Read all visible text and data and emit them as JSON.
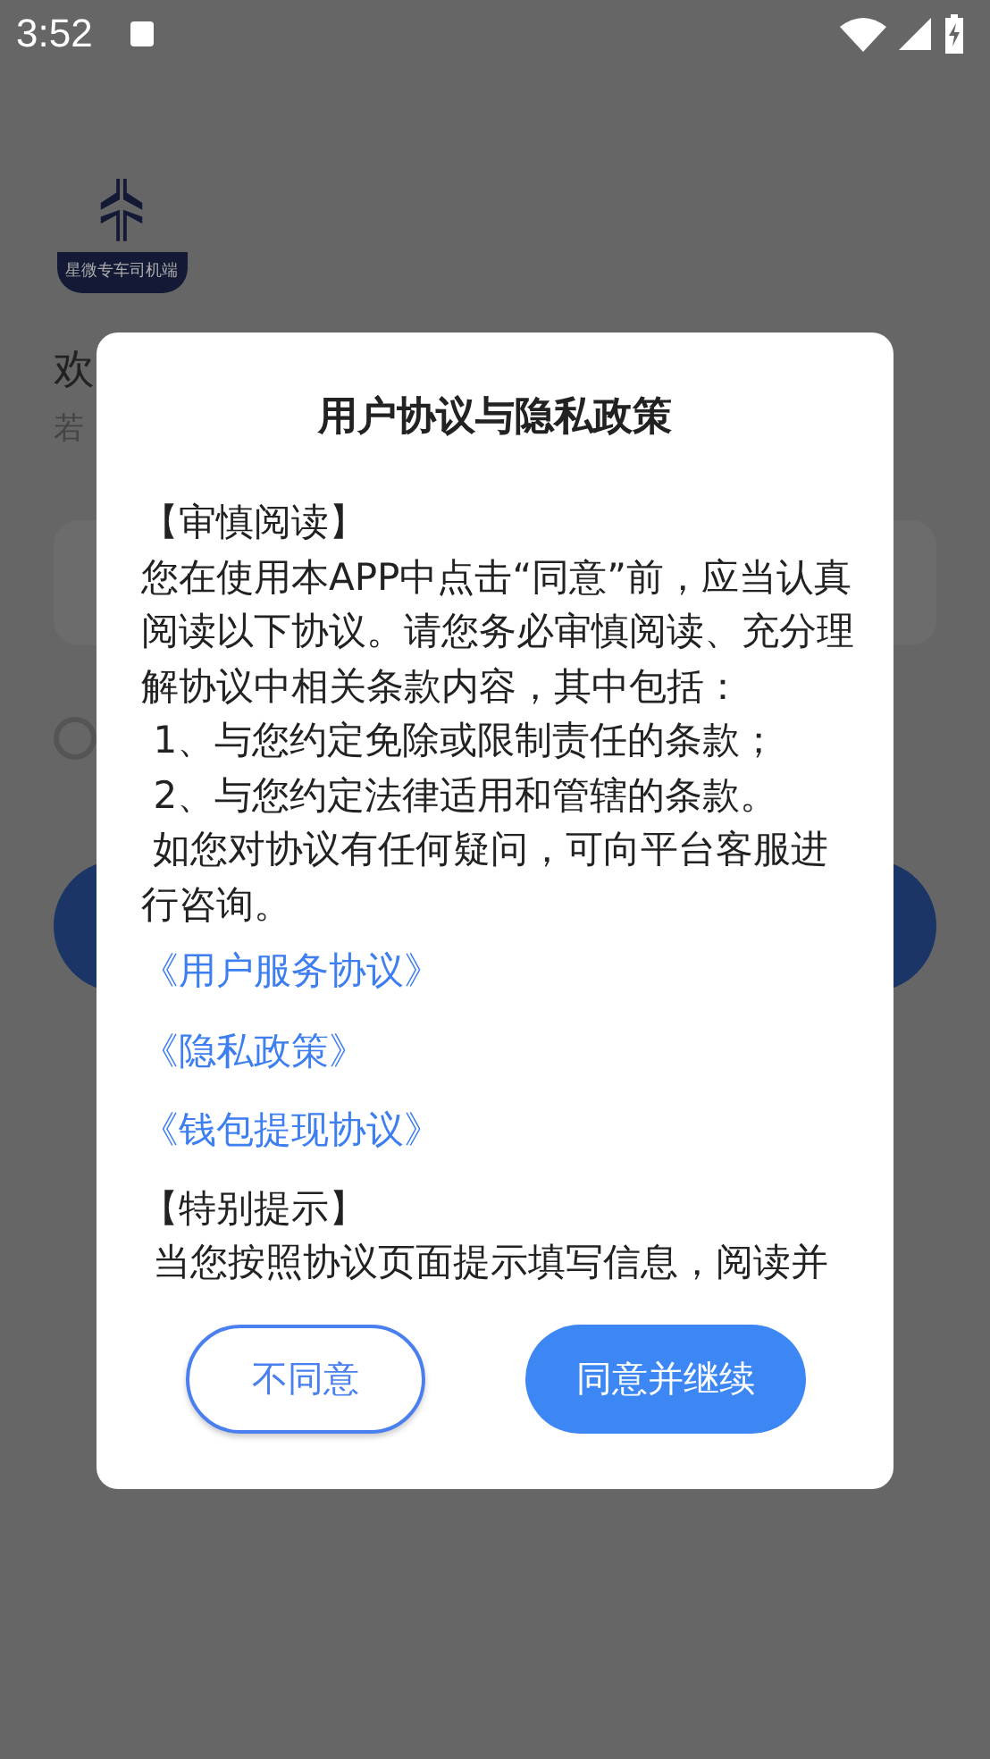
{
  "status_bar": {
    "time": "3:52"
  },
  "background_page": {
    "logo_caption": "星微专车司机端",
    "heading": "欢",
    "subtitle": "若",
    "agree_radio": {
      "checked": false
    }
  },
  "dialog": {
    "title": "用户协议与隐私政策",
    "paragraphs": [
      {
        "kind": "text",
        "text": "【审慎阅读】"
      },
      {
        "kind": "text",
        "text": "您在使用本APP中点击“同意”前，应当认真阅读以下协议。请您务必审慎阅读、充分理解协议中相关条款内容，其中包括："
      },
      {
        "kind": "text",
        "text": " 1、与您约定免除或限制责任的条款；"
      },
      {
        "kind": "text",
        "text": " 2、与您约定法律适用和管辖的条款。"
      },
      {
        "kind": "text",
        "text": " 如您对协议有任何疑问，可向平台客服进行咨询。"
      },
      {
        "kind": "link",
        "text": "《用户服务协议》"
      },
      {
        "kind": "link",
        "text": "《隐私政策》"
      },
      {
        "kind": "link",
        "text": "《钱包提现协议》"
      },
      {
        "kind": "heading",
        "text": "【特别提示】"
      },
      {
        "kind": "text",
        "text": " 当您按照协议页面提示填写信息，阅读并"
      }
    ],
    "buttons": [
      {
        "kind": "outline",
        "label": "不同意"
      },
      {
        "kind": "filled",
        "label": "同意并继续"
      }
    ]
  }
}
